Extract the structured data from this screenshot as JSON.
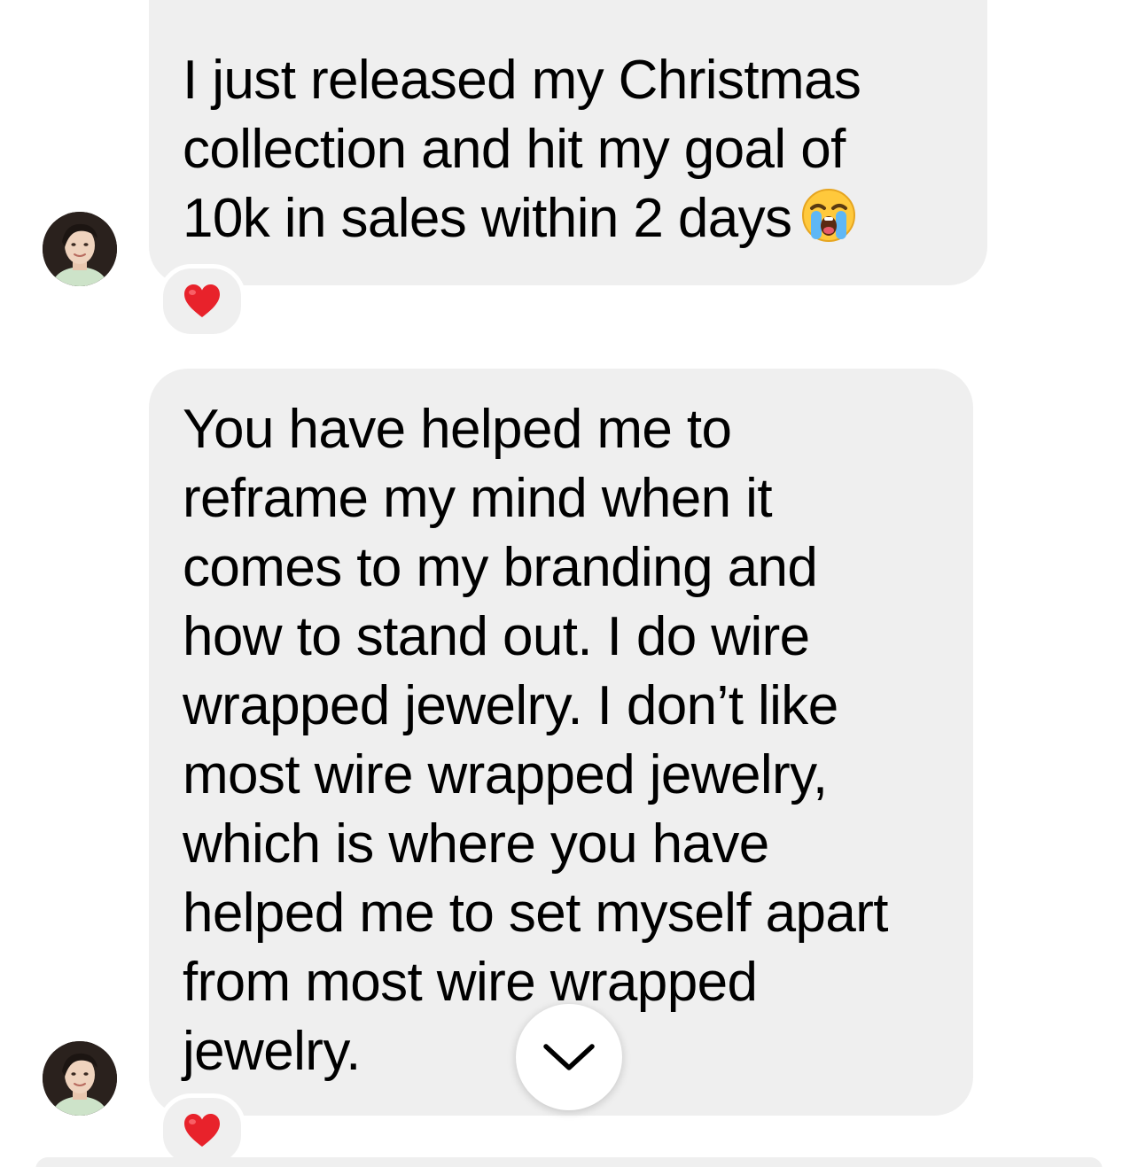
{
  "thread": {
    "messages": [
      {
        "text": "I just released my Christmas\ncollection and hit my goal of\n10k in sales within 2 days",
        "trailing_emoji": "loudly-crying-face",
        "reaction": "red-heart"
      },
      {
        "text": "You have helped me to\nreframe my mind when it\ncomes to my branding and\nhow to stand out. I do wire\nwrapped jewelry. I don’t like\nmost wire wrapped jewelry,\nwhich is where you have\nhelped me to set myself apart\nfrom most wire wrapped\njewelry.",
        "reaction": "red-heart"
      }
    ],
    "scroll_button_icon": "chevron-down-icon"
  },
  "colors": {
    "bubble_background": "#efefef",
    "page_background": "#ffffff",
    "heart": "#e8222b"
  }
}
